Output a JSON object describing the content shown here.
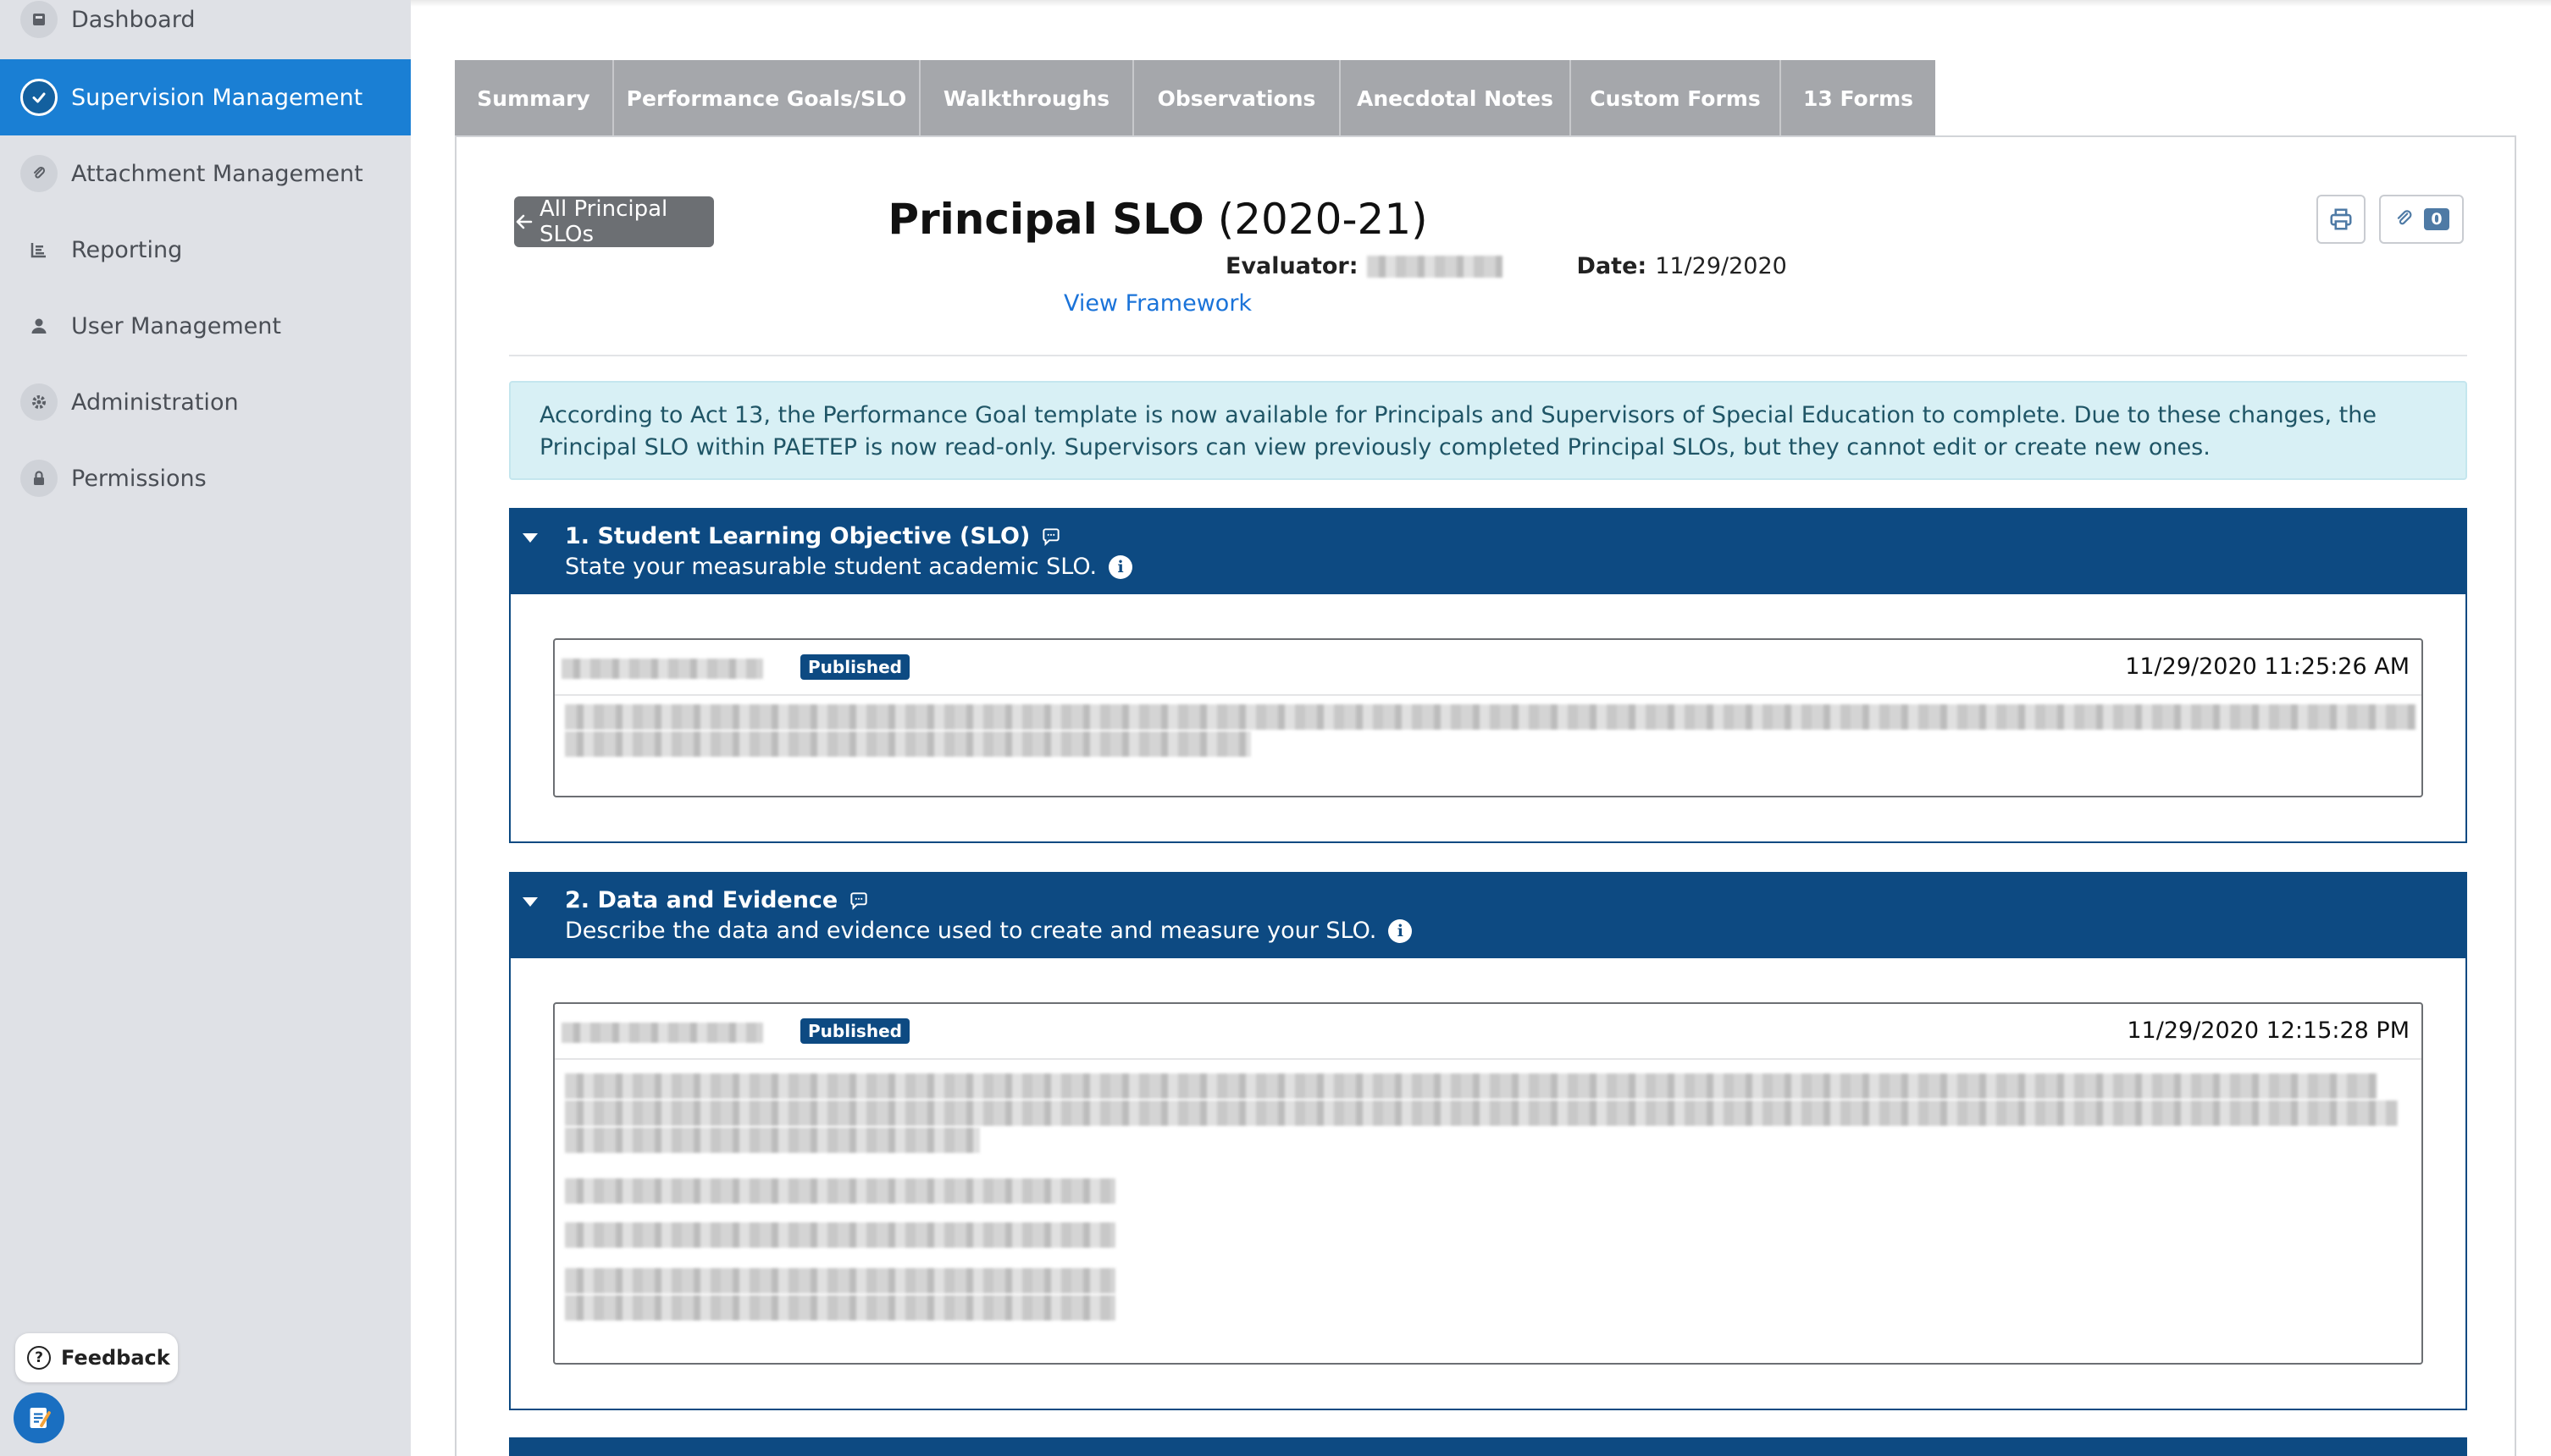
{
  "sidebar": {
    "items": [
      {
        "label": "Dashboard",
        "icon": "dashboard-icon",
        "active": false
      },
      {
        "label": "Supervision Management",
        "icon": "check-circle-icon",
        "active": true
      },
      {
        "label": "Attachment Management",
        "icon": "paperclip-icon",
        "active": false
      },
      {
        "label": "Reporting",
        "icon": "report-icon",
        "active": false
      },
      {
        "label": "User Management",
        "icon": "user-icon",
        "active": false
      },
      {
        "label": "Administration",
        "icon": "gear-icon",
        "active": false
      },
      {
        "label": "Permissions",
        "icon": "lock-icon",
        "active": false
      }
    ],
    "feedback_label": "Feedback"
  },
  "tabs": [
    {
      "label": "Summary"
    },
    {
      "label": "Performance Goals/SLO"
    },
    {
      "label": "Walkthroughs"
    },
    {
      "label": "Observations"
    },
    {
      "label": "Anecdotal Notes"
    },
    {
      "label": "Custom Forms"
    },
    {
      "label": "13 Forms"
    }
  ],
  "page": {
    "back_label": "All Principal SLOs",
    "title": "Principal SLO",
    "year": "(2020-21)",
    "evaluator_label": "Evaluator:",
    "date_label": "Date:",
    "date_value": "11/29/2020",
    "view_framework": "View Framework",
    "attachment_count": "0"
  },
  "notice": "According to Act 13, the Performance Goal template is now available for Principals and Supervisors of Special Education to complete. Due to these changes, the Principal SLO within PAETEP is now read-only. Supervisors can view previously completed Principal SLOs, but they cannot edit or create new ones.",
  "sections": [
    {
      "title": "1. Student Learning Objective (SLO)",
      "subtitle": "State your measurable student academic SLO.",
      "entry": {
        "status": "Published",
        "timestamp": "11/29/2020 11:25:26 AM"
      }
    },
    {
      "title": "2. Data and Evidence",
      "subtitle": "Describe the data and evidence used to create and measure your SLO.",
      "entry": {
        "status": "Published",
        "timestamp": "11/29/2020 12:15:28 PM"
      }
    }
  ],
  "colors": {
    "sidebar_bg": "#dfe1e6",
    "active_nav": "#1a7fd4",
    "tab_bg": "#a5a7ab",
    "section_header": "#0d4a82",
    "notice_bg": "#d8f0f5",
    "link": "#1a73d9"
  }
}
